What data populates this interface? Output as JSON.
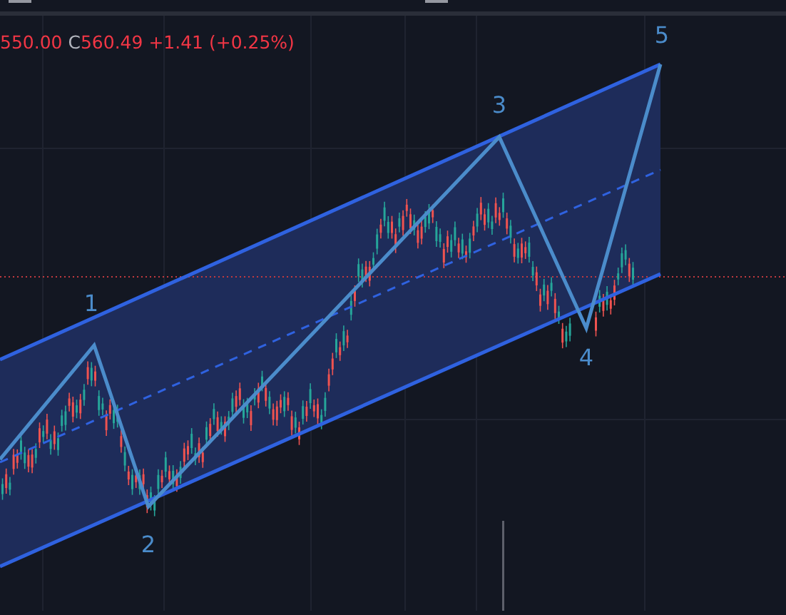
{
  "legend": {
    "open_cut": "550.00",
    "close_prefix": "C",
    "close": "560.49",
    "change": "+1.41",
    "change_percent": "(+0.25%)"
  },
  "wave_labels": [
    {
      "text": "1"
    },
    {
      "text": "2"
    },
    {
      "text": "3"
    },
    {
      "text": "4"
    },
    {
      "text": "5"
    }
  ]
}
